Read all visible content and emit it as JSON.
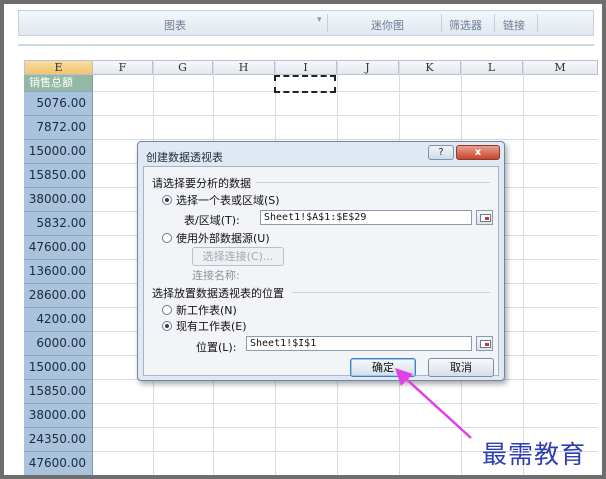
{
  "ribbon": {
    "groups": [
      "图表",
      "迷你图",
      "筛选器",
      "链接"
    ]
  },
  "columns": [
    "E",
    "F",
    "G",
    "H",
    "I",
    "J",
    "K",
    "L",
    "M"
  ],
  "selected_column": "E",
  "sheet": {
    "header": "销售总额",
    "values": [
      "5076.00",
      "7872.00",
      "15000.00",
      "15850.00",
      "38000.00",
      "5832.00",
      "47600.00",
      "13600.00",
      "28600.00",
      "4200.00",
      "6000.00",
      "15000.00",
      "15850.00",
      "38000.00",
      "24350.00",
      "47600.00"
    ]
  },
  "dialog": {
    "title": "创建数据透视表",
    "help_label": "?",
    "close_label": "x",
    "section_data": "请选择要分析的数据",
    "opt_table_range": "选择一个表或区域(S)",
    "table_range_label": "表/区域(T):",
    "table_range_value": "Sheet1!$A$1:$E$29",
    "opt_external": "使用外部数据源(U)",
    "choose_connection": "选择连接(C)...",
    "connection_name_label": "连接名称:",
    "section_location": "选择放置数据透视表的位置",
    "opt_new_sheet": "新工作表(N)",
    "opt_existing_sheet": "现有工作表(E)",
    "location_label": "位置(L):",
    "location_value": "Sheet1!$I$1",
    "ok_label": "确定",
    "cancel_label": "取消"
  },
  "watermark": "最需教育",
  "colors": {
    "column_e_fill": "#a9c3dd",
    "header_fill": "#93b8a3",
    "arrow": "#e040e8",
    "watermark": "#2d3fb0"
  }
}
